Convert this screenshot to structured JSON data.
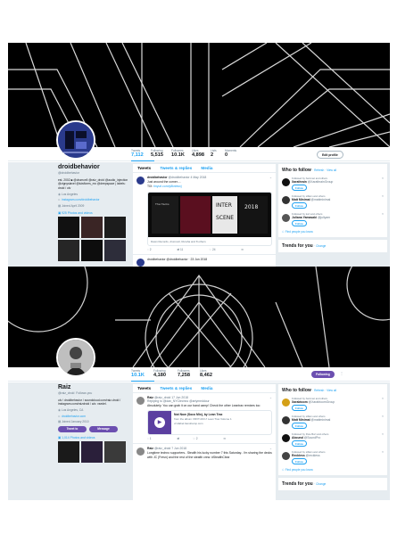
{
  "profile1": {
    "stats": [
      {
        "label": "Tweets",
        "value": "7,112"
      },
      {
        "label": "Following",
        "value": "5,515"
      },
      {
        "label": "Followers",
        "value": "10.1K"
      },
      {
        "label": "Likes",
        "value": "4,898"
      },
      {
        "label": "Lists",
        "value": "2"
      },
      {
        "label": "Moments",
        "value": "0"
      }
    ],
    "edit_button": "Edit profile",
    "name": "droidbehavior",
    "handle": "@droidbehavior",
    "bio": "est. 2002 ■ @drumcell @raiz_droid @audio_injection @zignyslavel @luisflores_mx @deepspace | labels: droid / ulv",
    "location": "Los Angeles",
    "link": "instagram.com/droidbehavior",
    "joined": "Joined April 2009",
    "photos": "925 Photos and videos",
    "tabs": [
      "Tweets",
      "Tweets & replies",
      "Media"
    ],
    "tweet": {
      "name": "droidbehavior",
      "handle": "@droidbehavior",
      "date": "4 May 2018",
      "text": "Just around the corner....",
      "link": "tinyurl.com/y8knbwxj",
      "card_meta": "Droid Behavior · Pinned",
      "card_sub": "Dawn Records, drumcell, Ruraha and 8 others",
      "actions": [
        "2",
        "11",
        "24"
      ]
    },
    "tweet2_head": "droidbehavior @droidbehavior · 23 Jun 2018",
    "wtf_title": "Who to follow",
    "wtf_refresh": "· Refresh · View all",
    "wtf": [
      {
        "context": "Followed by harmnet and others",
        "name": "Xarathrain",
        "handle": "@XarathrainGroup",
        "follow": "Follow"
      },
      {
        "context": "Followed by silliam and others",
        "name": "Matt Minimal",
        "handle": "@mattminimal",
        "follow": "Follow"
      },
      {
        "context": "Followed by kurt and others",
        "name": "Juliana Yamasaki",
        "handle": "@juliyam",
        "follow": "Follow"
      }
    ],
    "find_people": "Find people you know",
    "trends": "Trends for you",
    "trends_change": "· Change"
  },
  "profile2": {
    "stats": [
      {
        "label": "Tweets",
        "value": "10.1K"
      },
      {
        "label": "Following",
        "value": "4,180"
      },
      {
        "label": "Followers",
        "value": "7,258"
      },
      {
        "label": "Likes",
        "value": "8,462"
      }
    ],
    "following_button": "Following",
    "name": "Raiz",
    "handle": "@raiz_droid",
    "follows_you": "Follows you",
    "bio": "ulv / droidbehavior / soundcloud.com/raiz-droid / instagram.com/raizdroid / a/c: vsedel.",
    "location": "Los Angeles, CA",
    "link": "droidbehavior.com",
    "joined": "Joined January 2010",
    "tweet_to": "Tweet to",
    "message": "Message",
    "photos": "1,014 Photos and videos",
    "tabs": [
      "Tweets",
      "Tweets & replies",
      "Media"
    ],
    "tweet": {
      "name": "Raiz",
      "handle": "@raiz_droid",
      "date": "17 Jun 2018",
      "replying": "Replying to @dan_NYCtechno @artymeddour",
      "text": "Absolutely. You can grab it on our band camp! Check the other Leantrax remixes too",
      "card_title": "Not Now (Soco Mix), by Lean Trax",
      "card_desc": "from the album VRVT-003 // Lean Trax Volume 1",
      "card_url": "vrvtlabel.bandcamp.com",
      "actions": [
        "1",
        "",
        "2"
      ]
    },
    "tweet2": {
      "name": "Raiz",
      "handle": "@raiz_droid",
      "date": "7 Jun 2018",
      "text": "Longtime techno supporters.. Stealth his lucky number 7 this Saturday.. I'm sharing the decks with JC (Fresn) and the rest of the stealth crew. #StealthClear"
    },
    "wtf_title": "Who to follow",
    "wtf_refresh": "· Refresh · View all",
    "wtf": [
      {
        "context": "Followed by harmnet and others",
        "name": "Xarabtoom",
        "handle": "@XarabtoomGroup",
        "follow": "Follow"
      },
      {
        "context": "Followed by silliam and others",
        "name": "Matt Minimal",
        "handle": "@mattminimal",
        "follow": "Follow"
      },
      {
        "context": "Followed by Pete Bort and others",
        "name": "Abound",
        "handle": "@SoundPro",
        "follow": "Follow"
      },
      {
        "context": "Followed by silliam and others",
        "name": "Reckless",
        "handle": "@reckless",
        "follow": "Follow"
      }
    ],
    "find_people": "Find people you know",
    "trends": "Trends for you",
    "trends_change": "· Change"
  }
}
